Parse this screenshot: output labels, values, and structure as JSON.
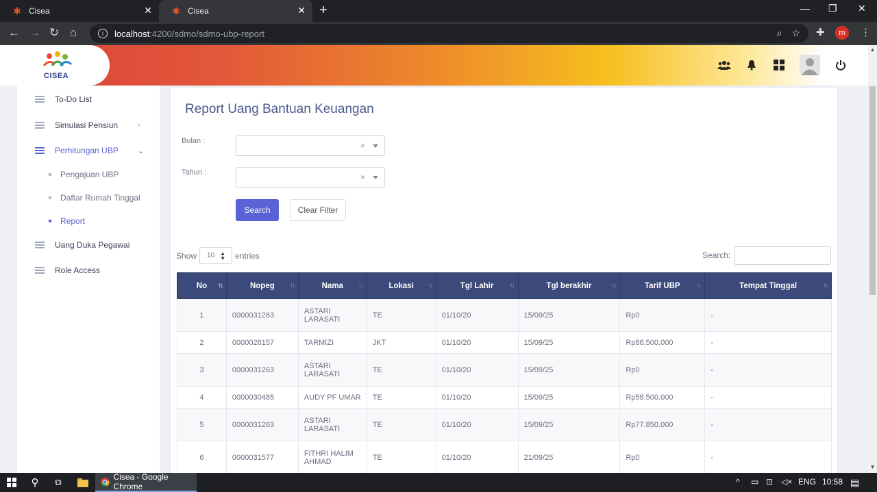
{
  "browser": {
    "tabs": [
      {
        "title": "Cisea",
        "active": false
      },
      {
        "title": "Cisea",
        "active": true
      }
    ],
    "url_host": "localhost",
    "url_path": ":4200/sdmo/sdmo-ubp-report",
    "profile_initial": "m"
  },
  "app": {
    "logo_text": "CISEA",
    "header_icons": [
      "users-icon",
      "bell-icon",
      "grid-icon",
      "avatar",
      "power-icon"
    ]
  },
  "sidebar": {
    "items": [
      {
        "label": "To-Do List"
      },
      {
        "label": "Simulasi Pensiun",
        "chevron": "›"
      },
      {
        "label": "Perhitungan UBP",
        "chevron": "⌄",
        "active": true
      },
      {
        "label": "Uang Duka Pegawai"
      },
      {
        "label": "Role Access"
      }
    ],
    "subitems": [
      {
        "label": "Pengajuan UBP"
      },
      {
        "label": "Daftar Rumah Tinggal"
      },
      {
        "label": "Report",
        "active": true
      }
    ]
  },
  "main": {
    "title": "Report Uang Bantuan Keuangan",
    "filters": {
      "bulan_label": "Bulan :",
      "tahun_label": "Tahun :",
      "clear_symbol": "×"
    },
    "search_button": "Search",
    "clear_button": "Clear Filter",
    "show_label": "Show",
    "entries_value": "10",
    "entries_label": "entries",
    "search_label": "Search:",
    "table": {
      "headers": [
        "No",
        "Nopeg",
        "Nama",
        "Lokasi",
        "Tgl Lahir",
        "Tgl berakhir",
        "Tarif UBP",
        "Tempat Tinggal"
      ],
      "rows": [
        [
          "1",
          "0000031263",
          "ASTARI LARASATI",
          "TE",
          "01/10/20",
          "15/09/25",
          "Rp0",
          "-"
        ],
        [
          "2",
          "0000026157",
          "TARMIZI",
          "JKT",
          "01/10/20",
          "15/09/25",
          "Rp86.500.000",
          "-"
        ],
        [
          "3",
          "0000031263",
          "ASTARI LARASATI",
          "TE",
          "01/10/20",
          "15/09/25",
          "Rp0",
          "-"
        ],
        [
          "4",
          "0000030485",
          "AUDY PF UMAR",
          "TE",
          "01/10/20",
          "15/09/25",
          "Rp58.500.000",
          "-"
        ],
        [
          "5",
          "0000031263",
          "ASTARI LARASATI",
          "TE",
          "01/10/20",
          "15/09/25",
          "Rp77.850.000",
          "-"
        ],
        [
          "6",
          "0000031577",
          "FITHRI HALIM AHMAD",
          "TE",
          "01/10/20",
          "21/09/25",
          "Rp0",
          "-"
        ]
      ]
    }
  },
  "taskbar": {
    "chrome_label": "Cisea - Google Chrome",
    "lang": "ENG",
    "time": "10:58"
  },
  "colors": {
    "accent": "#5a63d6",
    "table_header": "#3b4a7a",
    "title": "#4a5a8c"
  }
}
